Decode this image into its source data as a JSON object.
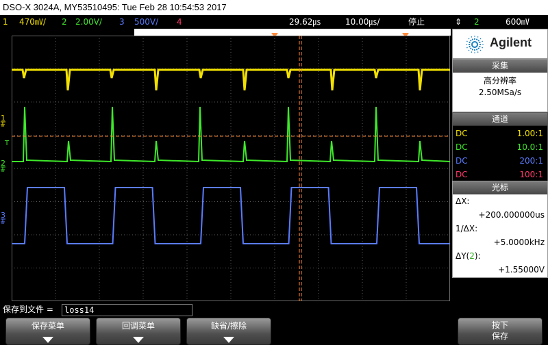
{
  "title": "DSO-X 3024A, MY53510495: Tue Feb 28 10:54:53 2017",
  "channels_bar": {
    "ch1_num": "1",
    "ch1_scale": "470㎷/",
    "ch2_num": "2",
    "ch2_scale": "2.00V/",
    "ch3_num": "3",
    "ch3_scale": "500V/",
    "ch4_num": "4",
    "time_pos": "29.62㎲",
    "time_scale": "10.00㎲/",
    "run_state": "停止",
    "trig_arrow": "⇕",
    "trig_ch": "2",
    "trig_level": "600㎷"
  },
  "markers": {
    "ch1": "1",
    "ch2": "2",
    "ch3": "3",
    "trig": "T"
  },
  "panel": {
    "brand": "Agilent",
    "acq_header": "采集",
    "acq_mode": "高分辨率",
    "sample_rate": "2.50MSa/s",
    "chan_header": "通道",
    "chan_rows": [
      {
        "coupling": "DC",
        "probe": "1.00:1",
        "color": "#f2e000"
      },
      {
        "coupling": "DC",
        "probe": "10.0:1",
        "color": "#3ee82a"
      },
      {
        "coupling": "DC",
        "probe": "200:1",
        "color": "#5a7cff"
      },
      {
        "coupling": "DC",
        "probe": "100:1",
        "color": "#ff3a6a"
      }
    ],
    "cursor_header": "光标",
    "dx_label": "ΔX:",
    "dx_value": "+200.000000us",
    "inv_dx_label": "1/ΔX:",
    "inv_dx_value": "+5.0000kHz",
    "dy_label_pre": "ΔY(",
    "dy_label_ch": "2",
    "dy_label_post": "):",
    "dy_value": "+1.55000V"
  },
  "file": {
    "label": "保存到文件 =",
    "value": "loss14"
  },
  "softkeys": {
    "save_menu": "保存菜单",
    "recall_menu": "回调菜单",
    "default_erase": "缺省/擦除",
    "press": "按下",
    "save": "保存"
  },
  "colors": {
    "ch1": "#f2e000",
    "ch2": "#3ee82a",
    "ch3": "#5a7cff",
    "ch4": "#ff3a6a",
    "cursor": "#ff8a3a",
    "grid": "#5a5a5a"
  },
  "icons": {
    "brand_logo": "starburst-icon",
    "softkey_arrow": "down-arrow-icon",
    "trigger_marker": "orange-triangle-icon"
  }
}
